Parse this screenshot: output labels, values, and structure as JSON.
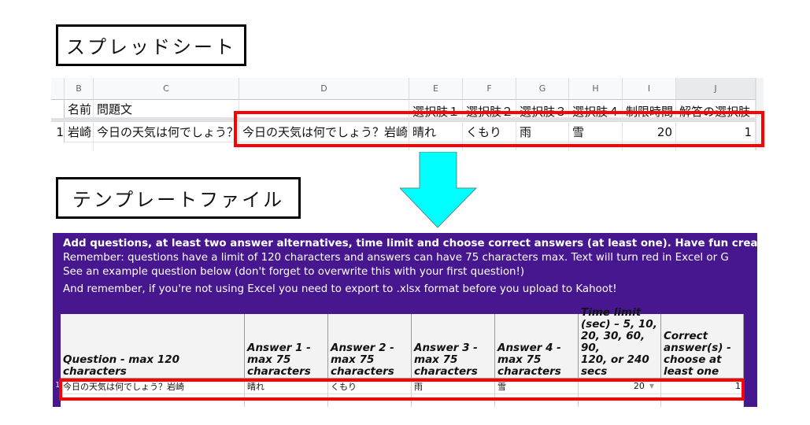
{
  "labels": {
    "spreadsheet": "スプレッドシート",
    "template_file": "テンプレートファイル"
  },
  "spreadsheet": {
    "columns": [
      "B",
      "C",
      "D",
      "E",
      "F",
      "G",
      "H",
      "I",
      "J"
    ],
    "selected_column": "J",
    "header_row": [
      "名前",
      "問題文",
      "",
      "選択肢１",
      "選択肢２",
      "選択肢３",
      "選択肢４",
      "制限時間",
      "解答の選択肢"
    ],
    "row_number": "1",
    "data_row": [
      "岩崎",
      "今日の天気は何でしょう？",
      "今日の天気は何でしょう？岩崎",
      "晴れ",
      "くもり",
      "雨",
      "雪",
      "20",
      "1"
    ]
  },
  "arrow": {
    "direction": "down",
    "color": "#00ffff",
    "icon": "arrow-down-icon"
  },
  "template": {
    "background": "#46178f",
    "instructions": [
      "Add questions, at least two answer alternatives, time limit and choose correct answers (at least one). Have fun creatin",
      "Remember: questions have a limit of 120 characters and answers can have 75 characters max. Text will turn red in Excel or G",
      "See an example question below (don't forget to overwrite this with your first question!)",
      "And remember,  if you're not using Excel you need to export to .xlsx format before you upload to Kahoot!"
    ],
    "headers": [
      [
        "Question - max 120 characters"
      ],
      [
        "Answer 1 -",
        "max 75",
        "characters"
      ],
      [
        "Answer 2 -",
        "max 75",
        "characters"
      ],
      [
        "Answer 3 -",
        "max 75",
        "characters"
      ],
      [
        "Answer 4 -",
        "max 75",
        "characters"
      ],
      [
        "Time limit",
        "(sec) – 5, 10,",
        "20, 30, 60, 90,",
        "120, or 240",
        "secs"
      ],
      [
        "Correct",
        "answer(s) -",
        "choose at",
        "least one"
      ]
    ],
    "row_number": "1",
    "row": [
      "今日の天気は何でしょう？岩崎",
      "晴れ",
      "くもり",
      "雨",
      "雪",
      "20",
      "1"
    ],
    "time_limit_dropdown_icon": "chevron-down-icon"
  },
  "highlight_color": "#ff0000"
}
